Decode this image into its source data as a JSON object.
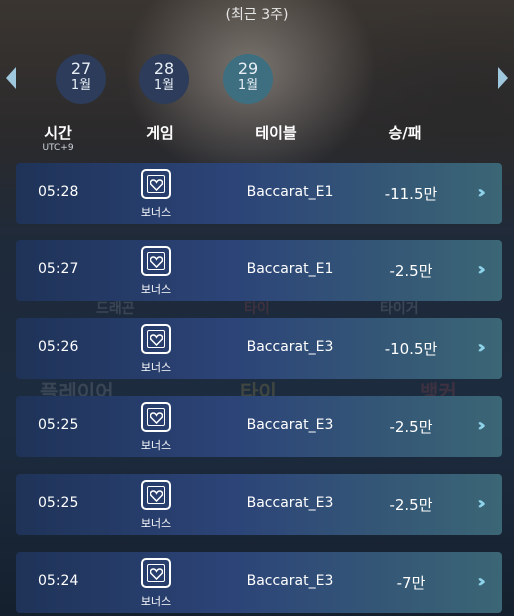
{
  "header": {
    "period_label": "(최근 3주)"
  },
  "dates": [
    {
      "day": "27",
      "month": "1월"
    },
    {
      "day": "28",
      "month": "1월"
    },
    {
      "day": "29",
      "month": "1월"
    }
  ],
  "columns": {
    "time": "시간",
    "time_sub": "UTC+9",
    "game": "게임",
    "table": "테이블",
    "result": "승/패"
  },
  "rows": [
    {
      "time": "05:28",
      "game": "보너스",
      "table": "Baccarat_E1",
      "result": "-11.5만"
    },
    {
      "time": "05:27",
      "game": "보너스",
      "table": "Baccarat_E1",
      "result": "-2.5만"
    },
    {
      "time": "05:26",
      "game": "보너스",
      "table": "Baccarat_E3",
      "result": "-10.5만"
    },
    {
      "time": "05:25",
      "game": "보너스",
      "table": "Baccarat_E3",
      "result": "-2.5만"
    },
    {
      "time": "05:25",
      "game": "보너스",
      "table": "Baccarat_E3",
      "result": "-2.5만"
    },
    {
      "time": "05:24",
      "game": "보너스",
      "table": "Baccarat_E3",
      "result": "-7만"
    }
  ],
  "background_labels": {
    "dragon": "드래곤",
    "tie": "타이",
    "tiger": "타이거",
    "player": "플레이어",
    "banker": "뱅커"
  },
  "icons": {
    "left_arrow": "left-arrow-icon",
    "right_arrow": "right-arrow-icon",
    "game": "bonus-card-icon",
    "detail": "double-chevron-right-icon"
  },
  "colors": {
    "active_date": "#3d6f80",
    "inactive_date": "#2c3c5a",
    "chevron": "#8ed3ea"
  }
}
